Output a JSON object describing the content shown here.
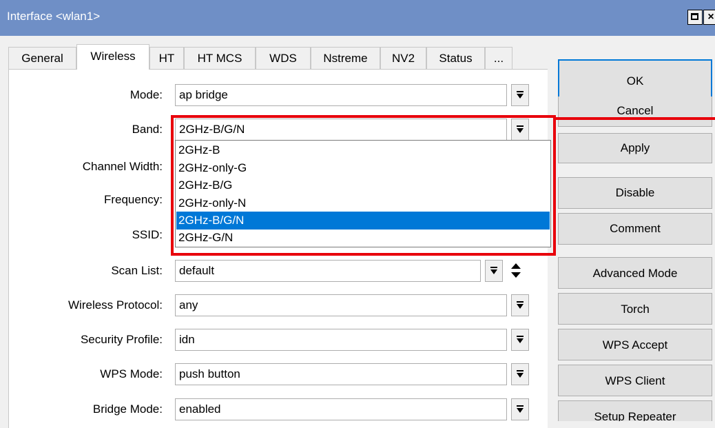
{
  "window": {
    "title": "Interface <wlan1>"
  },
  "tabs": [
    {
      "label": "General"
    },
    {
      "label": "Wireless"
    },
    {
      "label": "HT"
    },
    {
      "label": "HT MCS"
    },
    {
      "label": "WDS"
    },
    {
      "label": "Nstreme"
    },
    {
      "label": "NV2"
    },
    {
      "label": "Status"
    },
    {
      "label": "..."
    }
  ],
  "form": {
    "mode": {
      "label": "Mode:",
      "value": "ap bridge"
    },
    "band": {
      "label": "Band:",
      "value": "2GHz-B/G/N"
    },
    "channel_width": {
      "label": "Channel Width:"
    },
    "frequency": {
      "label": "Frequency:"
    },
    "ssid": {
      "label": "SSID:"
    },
    "scan_list": {
      "label": "Scan List:",
      "value": "default"
    },
    "wireless_protocol": {
      "label": "Wireless Protocol:",
      "value": "any"
    },
    "security_profile": {
      "label": "Security Profile:",
      "value": "idn"
    },
    "wps_mode": {
      "label": "WPS Mode:",
      "value": "push button"
    },
    "bridge_mode": {
      "label": "Bridge Mode:",
      "value": "enabled"
    }
  },
  "band_dropdown": {
    "options": [
      "2GHz-B",
      "2GHz-only-G",
      "2GHz-B/G",
      "2GHz-only-N",
      "2GHz-B/G/N",
      "2GHz-G/N"
    ],
    "selected": "2GHz-B/G/N"
  },
  "buttons": {
    "ok": "OK",
    "cancel": "Cancel",
    "apply": "Apply",
    "disable": "Disable",
    "comment": "Comment",
    "advanced_mode": "Advanced Mode",
    "torch": "Torch",
    "wps_accept": "WPS Accept",
    "wps_client": "WPS Client",
    "setup_repeater": "Setup Repeater"
  },
  "colors": {
    "titlebar": "#6f8fc6",
    "selection": "#0078d7",
    "highlight": "#e8000b"
  }
}
